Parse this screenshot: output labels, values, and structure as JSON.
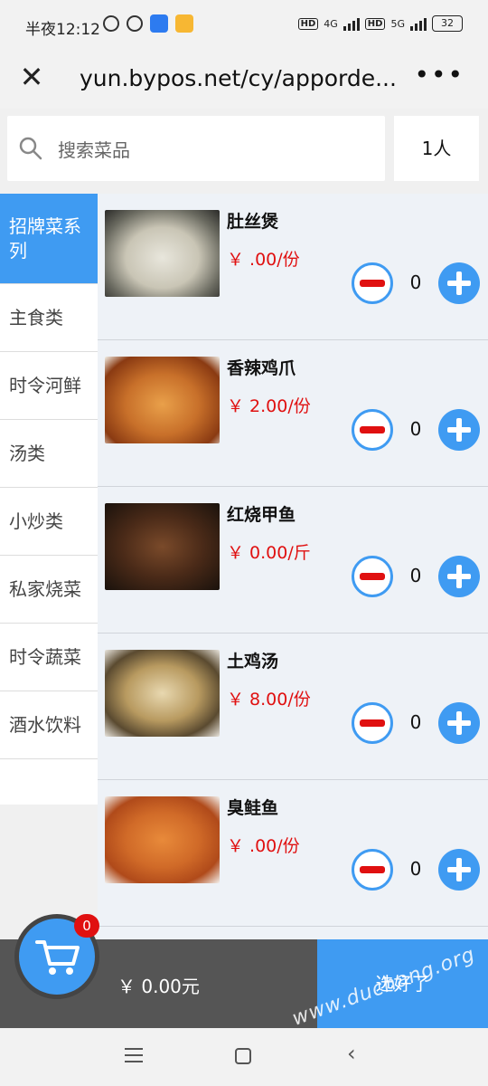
{
  "status_bar": {
    "time": "半夜12:12",
    "net1": "4G",
    "net2": "5G",
    "battery": "32"
  },
  "browser": {
    "url": "yun.bypos.net/cy/apporde..."
  },
  "search": {
    "placeholder": "搜索菜品",
    "people": "1人"
  },
  "categories": [
    {
      "label": "招牌菜系列",
      "active": true
    },
    {
      "label": "主食类",
      "active": false
    },
    {
      "label": "时令河鲜",
      "active": false
    },
    {
      "label": "汤类",
      "active": false
    },
    {
      "label": "小炒类",
      "active": false
    },
    {
      "label": "私家烧菜",
      "active": false
    },
    {
      "label": "时令蔬菜",
      "active": false
    },
    {
      "label": "酒水饮料",
      "active": false
    }
  ],
  "dishes": [
    {
      "name": "肚丝煲",
      "price": "￥ .00/份",
      "qty": "0"
    },
    {
      "name": "香辣鸡爪",
      "price": "￥ 2.00/份",
      "qty": "0"
    },
    {
      "name": "红烧甲鱼",
      "price": "￥ 0.00/斤",
      "qty": "0"
    },
    {
      "name": "土鸡汤",
      "price": "￥ 8.00/份",
      "qty": "0"
    },
    {
      "name": "臭鲑鱼",
      "price": "￥ .00/份",
      "qty": "0"
    }
  ],
  "cart": {
    "count": "0",
    "total": "￥ 0.00元",
    "checkout": "选好了"
  },
  "watermark": "www.duchang.org",
  "colors": {
    "accent": "#3f9bf2",
    "price": "#e01010",
    "cartbar": "#555555"
  }
}
